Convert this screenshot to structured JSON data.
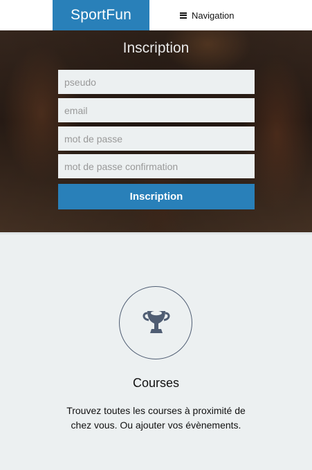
{
  "header": {
    "brand": "SportFun",
    "nav_label": "Navigation"
  },
  "signup": {
    "title": "Inscription",
    "fields": {
      "pseudo": "pseudo",
      "email": "email",
      "password": "mot de passe",
      "password_confirm": "mot de passe confirmation"
    },
    "submit_label": "Inscription"
  },
  "feature": {
    "icon": "trophy-icon",
    "title": "Courses",
    "description": "Trouvez toutes les courses à proximité de chez vous. Ou ajouter vos évènements."
  },
  "colors": {
    "accent": "#2980b9",
    "background": "#ecf0f1",
    "icon": "#4f5d73"
  }
}
